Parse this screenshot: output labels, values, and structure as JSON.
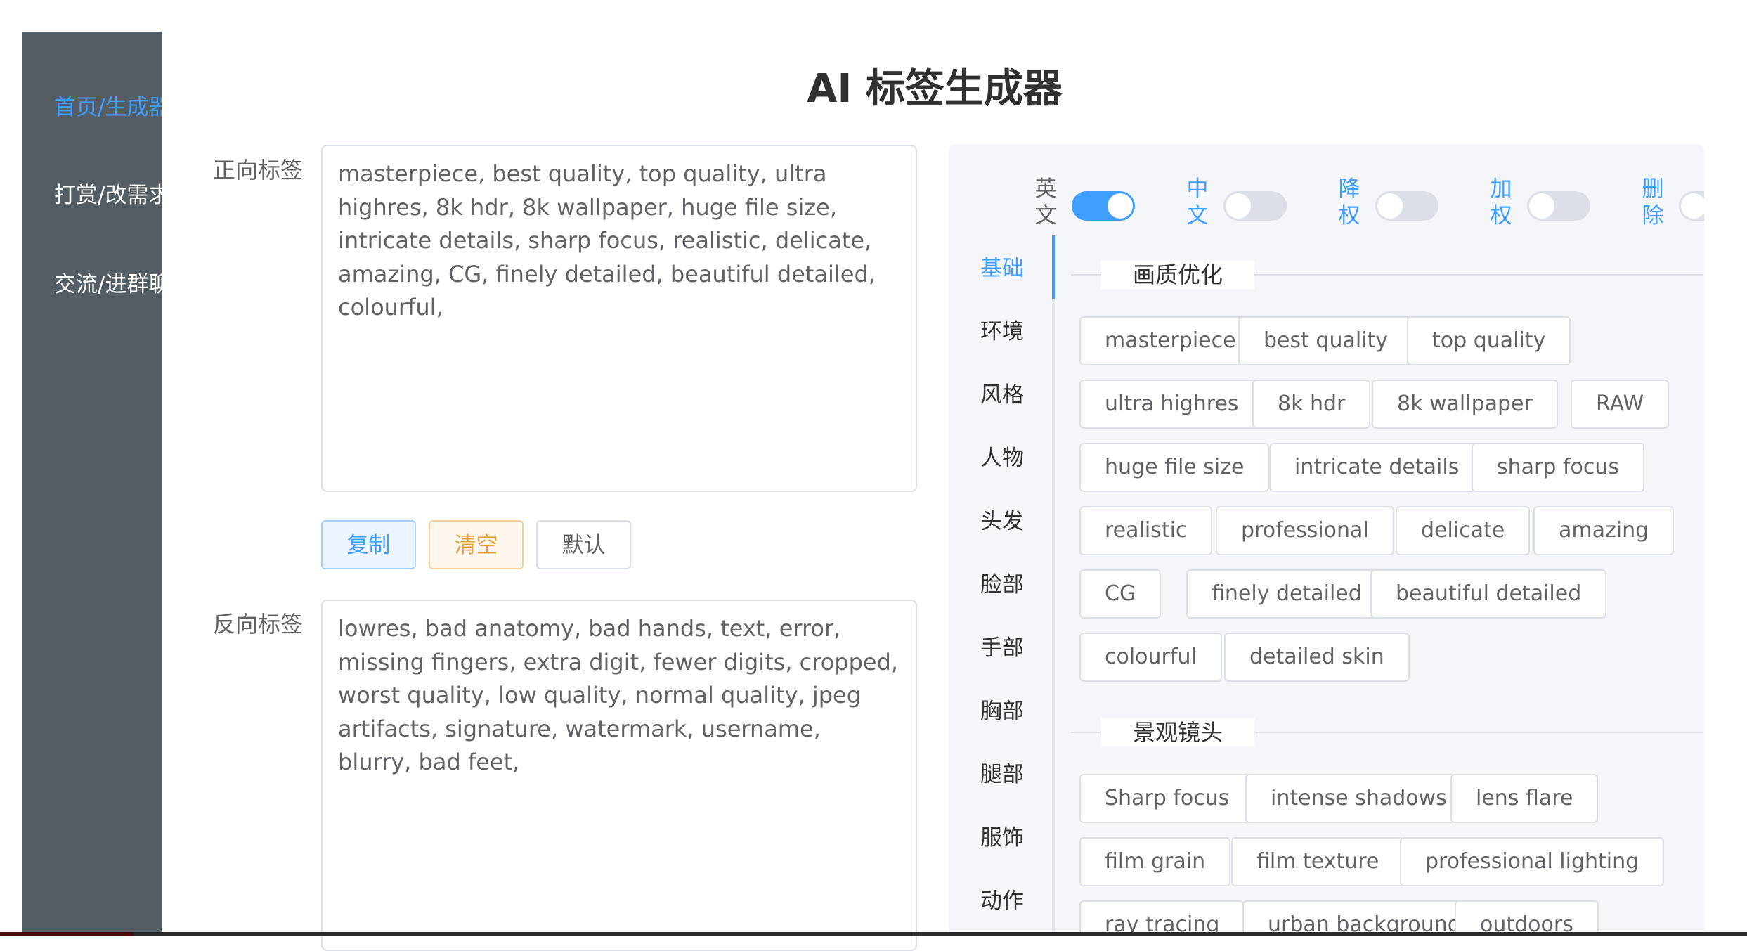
{
  "sidebar": {
    "items": [
      {
        "label": "首页/生成器",
        "active": true
      },
      {
        "label": "打赏/改需求",
        "active": false
      },
      {
        "label": "交流/进群聊",
        "active": false
      }
    ]
  },
  "title": "AI 标签生成器",
  "positive": {
    "label": "正向标签",
    "value": "masterpiece, best quality, top quality, ultra highres, 8k hdr, 8k wallpaper, huge file size, intricate details, sharp focus, realistic, delicate, amazing, CG, finely detailed, beautiful detailed, colourful,"
  },
  "buttons": {
    "copy": "复制",
    "clear": "清空",
    "default": "默认"
  },
  "negative": {
    "label": "反向标签",
    "value": "lowres, bad anatomy, bad hands, text, error, missing fingers, extra digit, fewer digits, cropped, worst quality, low quality, normal quality, jpeg artifacts, signature, watermark, username, blurry, bad feet,"
  },
  "switches": [
    {
      "label": "英文",
      "on": true
    },
    {
      "label": "中文",
      "on": false
    },
    {
      "label": "降权",
      "on": false
    },
    {
      "label": "加权",
      "on": false
    },
    {
      "label": "删除",
      "on": false
    }
  ],
  "tabs": [
    {
      "label": "基础",
      "active": true
    },
    {
      "label": "环境",
      "active": false
    },
    {
      "label": "风格",
      "active": false
    },
    {
      "label": "人物",
      "active": false
    },
    {
      "label": "头发",
      "active": false
    },
    {
      "label": "脸部",
      "active": false
    },
    {
      "label": "手部",
      "active": false
    },
    {
      "label": "胸部",
      "active": false
    },
    {
      "label": "腿部",
      "active": false
    },
    {
      "label": "服饰",
      "active": false
    },
    {
      "label": "动作",
      "active": false
    }
  ],
  "sections": [
    {
      "title": "画质优化",
      "rows": [
        [
          "masterpiece",
          "best quality",
          "top quality"
        ],
        [
          "ultra highres",
          "8k hdr",
          "8k wallpaper",
          "RAW"
        ],
        [
          "huge file size",
          "intricate details",
          "sharp focus"
        ],
        [
          "realistic",
          "professional",
          "delicate",
          "amazing"
        ],
        [
          "CG",
          "finely detailed",
          "beautiful detailed"
        ],
        [
          "colourful",
          "detailed skin"
        ]
      ]
    },
    {
      "title": "景观镜头",
      "rows": [
        [
          "Sharp focus",
          "intense shadows",
          "lens flare"
        ],
        [
          "film grain",
          "film texture",
          "professional lighting"
        ],
        [
          "ray tracing",
          "urban background",
          "outdoors"
        ]
      ]
    }
  ],
  "colors": {
    "sidebar_bg": "#545c64",
    "accent": "#409eff",
    "warning": "#e6a23c",
    "panel_bg": "#f4f6f9"
  }
}
